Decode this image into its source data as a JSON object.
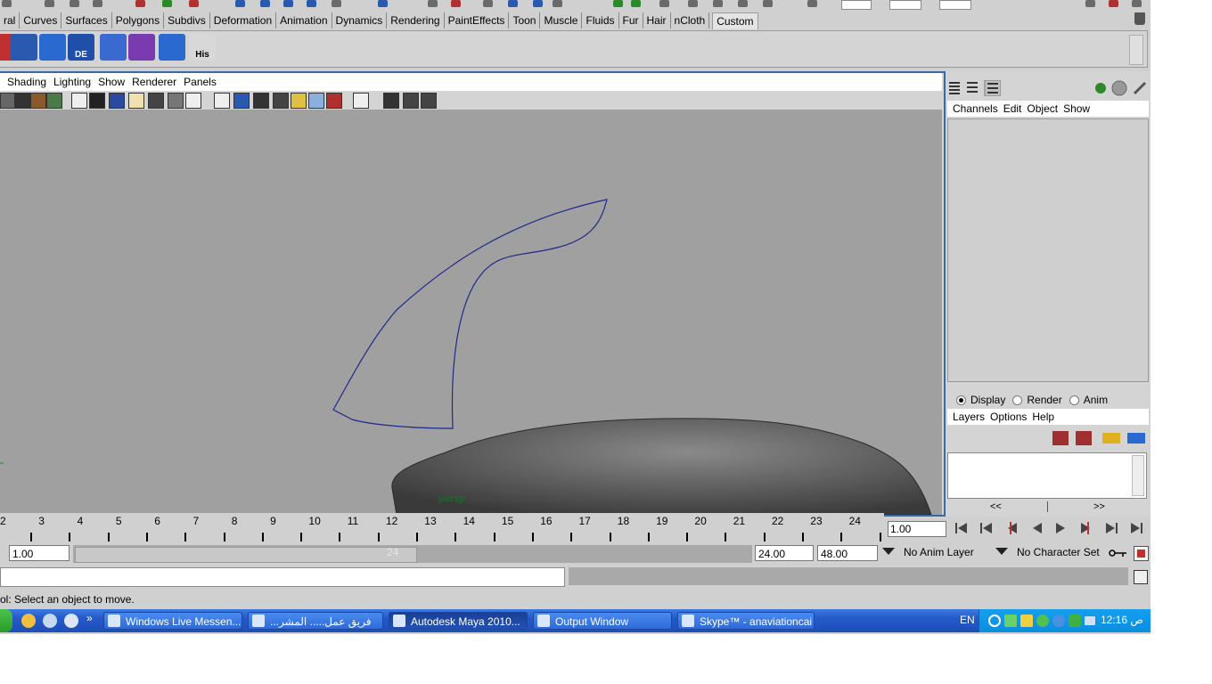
{
  "shelf_tabs": [
    "ral",
    "Curves",
    "Surfaces",
    "Polygons",
    "Subdivs",
    "Deformation",
    "Animation",
    "Dynamics",
    "Rendering",
    "PaintEffects",
    "Toon",
    "Muscle",
    "Fluids",
    "Fur",
    "Hair",
    "nCloth"
  ],
  "shelf_selected_tab": "Custom",
  "shelf_icons": [
    {
      "name": "shelf-tool-1-icon",
      "label": ""
    },
    {
      "name": "shelf-tool-2-icon",
      "label": ""
    },
    {
      "name": "shelf-tool-3-icon",
      "label": ""
    },
    {
      "name": "shelf-tool-4-icon",
      "label": "DE"
    },
    {
      "name": "shelf-tool-5-icon",
      "label": ""
    },
    {
      "name": "shelf-tool-6-icon",
      "label": ""
    },
    {
      "name": "shelf-tool-7-icon",
      "label": ""
    },
    {
      "name": "shelf-tool-8-icon",
      "label": "His"
    }
  ],
  "viewport": {
    "menus": [
      "Shading",
      "Lighting",
      "Show",
      "Renderer",
      "Panels"
    ],
    "camera_label": "persp",
    "background_color": "#a0a0a0",
    "curve_color": "#1c2a8c"
  },
  "channel_box": {
    "menus": [
      "Channels",
      "Edit",
      "Object",
      "Show"
    ]
  },
  "layer_editor": {
    "modes": [
      "Display",
      "Render",
      "Anim"
    ],
    "selected_mode": "Display",
    "menus": [
      "Layers",
      "Options",
      "Help"
    ],
    "nav_prev": "<<",
    "nav_next": ">>"
  },
  "time_slider": {
    "ticks": [
      "2",
      "3",
      "4",
      "5",
      "6",
      "7",
      "8",
      "9",
      "10",
      "11",
      "12",
      "13",
      "14",
      "15",
      "16",
      "17",
      "18",
      "19",
      "20",
      "21",
      "22",
      "23",
      "24"
    ],
    "current_frame": "1.00"
  },
  "range_slider": {
    "start_time": "1.00",
    "range_end_label": "24",
    "end_time": "24.00",
    "max_time": "48.00",
    "anim_layer": "No Anim Layer",
    "character_set": "No Character Set"
  },
  "help_line": "ol: Select an object to move.",
  "taskbar": {
    "items": [
      {
        "label": "Windows Live Messen...",
        "active": false
      },
      {
        "label": "...فريق عمل..... المشر",
        "active": false
      },
      {
        "label": "Autodesk Maya 2010...",
        "active": true
      },
      {
        "label": "Output Window",
        "active": false
      },
      {
        "label": "Skype™ - anaviationcai",
        "active": false
      }
    ],
    "language": "EN",
    "clock": "12:16 ص",
    "quicklaunch_more": "»"
  }
}
